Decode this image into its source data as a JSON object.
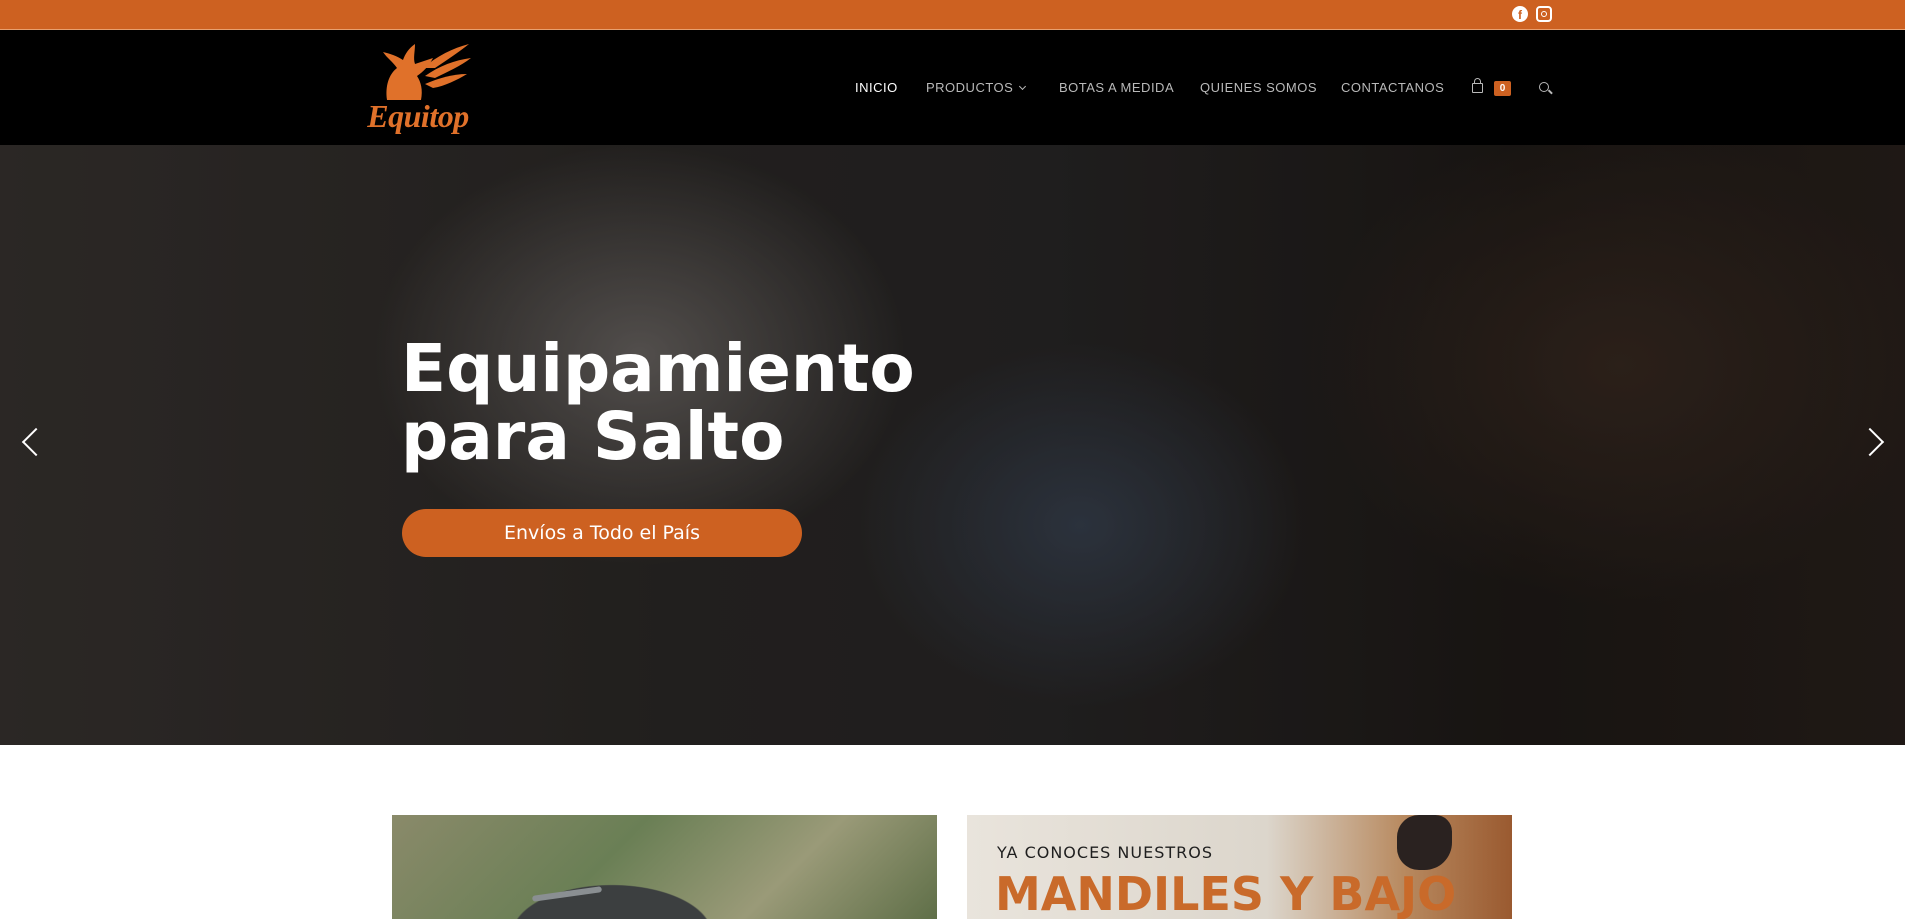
{
  "topbar": {
    "social": [
      "facebook-icon",
      "instagram-icon"
    ],
    "color": "#cd6121"
  },
  "header": {
    "logo_text": "Equitop",
    "nav": [
      {
        "label": "INICIO",
        "active": true
      },
      {
        "label": "PRODUCTOS",
        "has_dropdown": true
      },
      {
        "label": "BOTAS A MEDIDA"
      },
      {
        "label": "QUIENES SOMOS"
      },
      {
        "label": "CONTACTANOS"
      }
    ],
    "cart_count": "0",
    "icons": {
      "cart": "cart-icon",
      "search": "search-icon",
      "dropdown": "chevron-down-icon"
    }
  },
  "hero": {
    "title_line1": "Equipamiento",
    "title_line2": "para Salto",
    "button_label": "Envíos a Todo el País",
    "icons": {
      "prev": "chevron-left-icon",
      "next": "chevron-right-icon"
    }
  },
  "banners": {
    "right_kicker": "YA CONOCES NUESTROS",
    "right_headline": "MANDILES Y BAJO"
  },
  "colors": {
    "accent": "#cd6121",
    "nav_bg": "#000000"
  }
}
